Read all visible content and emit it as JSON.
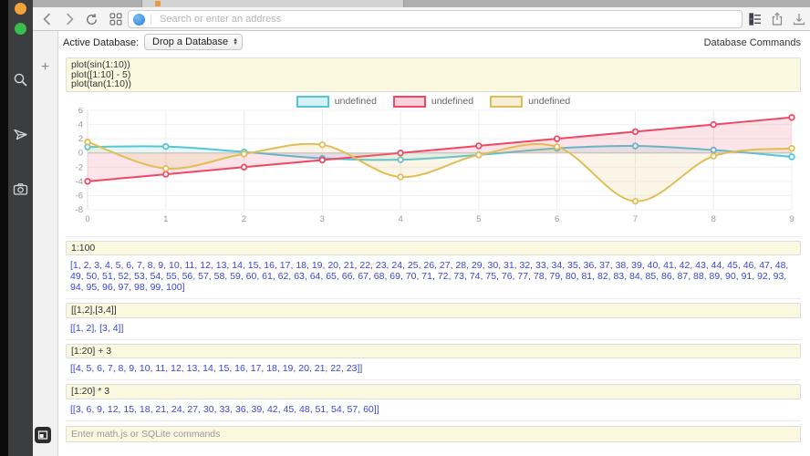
{
  "browser": {
    "address_placeholder": "Search or enter an address"
  },
  "gutter": {
    "add_button": "+"
  },
  "app": {
    "active_database_label": "Active Database:",
    "database_dropdown_value": "Drop a Database",
    "database_commands_label": "Database Commands",
    "input_placeholder": "Enter math.js or SQLite commands"
  },
  "commands": [
    {
      "input": "plot(sin(1:10))\nplot([1:10] - 5)\nplot(tan(1:10))",
      "output_kind": "chart"
    },
    {
      "input": "1:100",
      "output_kind": "text",
      "output": "[1, 2, 3, 4, 5, 6, 7, 8, 9, 10, 11, 12, 13, 14, 15, 16, 17, 18, 19, 20, 21, 22, 23, 24, 25, 26, 27, 28, 29, 30, 31, 32, 33, 34, 35, 36, 37, 38, 39, 40, 41, 42, 43, 44, 45, 46, 47, 48, 49, 50, 51, 52, 53, 54, 55, 56, 57, 58, 59, 60, 61, 62, 63, 64, 65, 66, 67, 68, 69, 70, 71, 72, 73, 74, 75, 76, 77, 78, 79, 80, 81, 82, 83, 84, 85, 86, 87, 88, 89, 90, 91, 92, 93, 94, 95, 96, 97, 98, 99, 100]"
    },
    {
      "input": "[[1,2],[3,4]]",
      "output_kind": "text",
      "output": "[[1, 2], [3, 4]]"
    },
    {
      "input": "[1:20] + 3",
      "output_kind": "text",
      "output": "[[4, 5, 6, 7, 8, 9, 10, 11, 12, 13, 14, 15, 16, 17, 18, 19, 20, 21, 22, 23]]"
    },
    {
      "input": "[1:20] * 3",
      "output_kind": "text",
      "output": "[[3, 6, 9, 12, 15, 18, 21, 24, 27, 30, 33, 36, 39, 42, 45, 48, 51, 54, 57, 60]]"
    }
  ],
  "chart_data": {
    "type": "line",
    "title": "",
    "xlabel": "",
    "ylabel": "",
    "x": [
      0,
      1,
      2,
      3,
      4,
      5,
      6,
      7,
      8,
      9
    ],
    "xlim": [
      0,
      9
    ],
    "ylim": [
      -8,
      6
    ],
    "xticks": [
      0,
      1,
      2,
      3,
      4,
      5,
      6,
      7,
      8,
      9
    ],
    "yticks": [
      -8,
      -6,
      -4,
      -2,
      0,
      2,
      4,
      6
    ],
    "grid": true,
    "legend_position": "top",
    "series": [
      {
        "name": "undefined",
        "color": "#55C6D6",
        "values": [
          0.841,
          0.909,
          0.141,
          -0.757,
          -0.959,
          -0.279,
          0.657,
          0.989,
          0.412,
          -0.544
        ]
      },
      {
        "name": "undefined",
        "color": "#EE4866",
        "values": [
          -4,
          -3,
          -2,
          -1,
          0,
          1,
          2,
          3,
          4,
          5
        ]
      },
      {
        "name": "undefined",
        "color": "#E0BE57",
        "values": [
          1.557,
          -2.185,
          -0.143,
          1.158,
          -3.381,
          -0.291,
          0.871,
          -6.8,
          -0.452,
          0.648
        ]
      }
    ]
  }
}
